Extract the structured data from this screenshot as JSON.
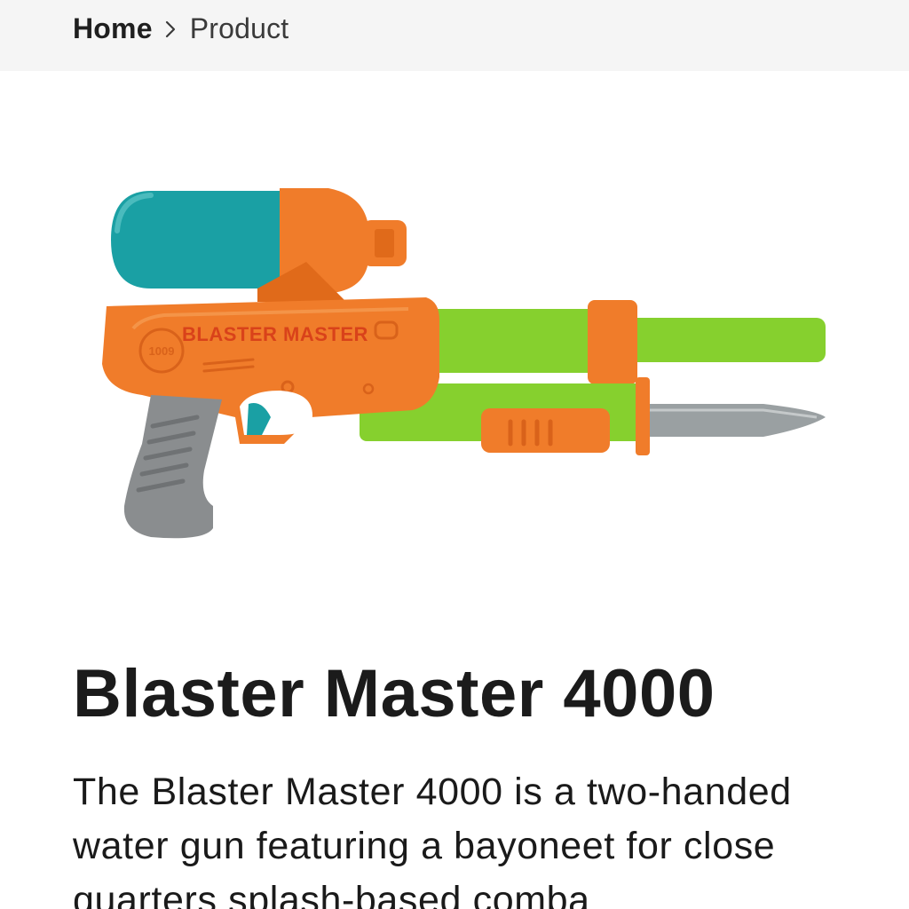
{
  "breadcrumb": {
    "home": "Home",
    "current": "Product"
  },
  "product": {
    "image_label": "BLASTER MASTER",
    "image_badge": "1009",
    "title": "Blaster Master 4000",
    "description": "The Blaster Master 4000 is a two-handed water gun featuring a bayoneet for close quarters splash-based comba"
  },
  "colors": {
    "topbar_bg": "#f5f5f5",
    "body_orange": "#f07c2a",
    "tank_teal": "#1aa0a4",
    "barrel_green": "#86d02e",
    "grip_gray": "#8a8d8f",
    "blade_gray": "#9aa0a2"
  },
  "icons": {
    "breadcrumb_separator": "chevron-right-icon"
  }
}
